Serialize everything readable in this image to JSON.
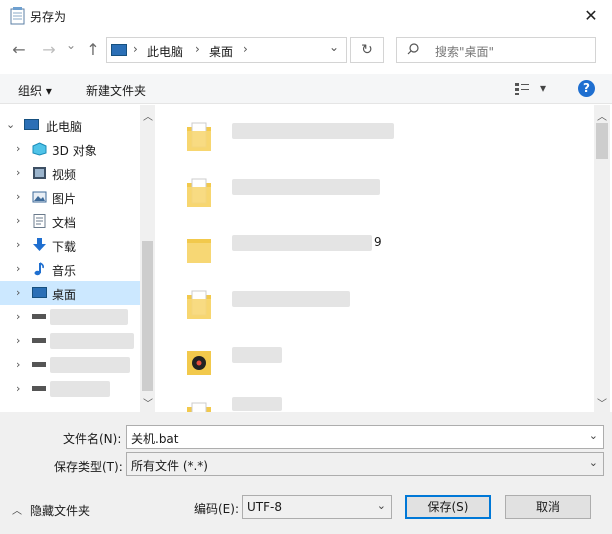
{
  "window": {
    "title": "另存为",
    "close_glyph": "✕"
  },
  "nav": {
    "back": "←",
    "forward": "→",
    "recent": "⌄",
    "up": "↑",
    "breadcrumb": [
      "此电脑",
      "桌面"
    ],
    "crumb_sep": "›",
    "dropdown": "⌄",
    "refresh": "↻",
    "search_placeholder": "搜索\"桌面\""
  },
  "toolbar": {
    "organize": "组织 ▾",
    "new_folder": "新建文件夹",
    "view_arrow": "▾",
    "help": "?"
  },
  "tree": [
    {
      "label": "此电脑",
      "icon": "pc-icon",
      "expanded": true,
      "selected": false,
      "indent": 0,
      "chev": "⌄"
    },
    {
      "label": "3D 对象",
      "icon": "3d-objects-icon",
      "selected": false,
      "indent": 1,
      "chev": "›"
    },
    {
      "label": "视频",
      "icon": "video-icon",
      "selected": false,
      "indent": 1,
      "chev": "›"
    },
    {
      "label": "图片",
      "icon": "picture-icon",
      "selected": false,
      "indent": 1,
      "chev": "›"
    },
    {
      "label": "文档",
      "icon": "document-icon",
      "selected": false,
      "indent": 1,
      "chev": "›"
    },
    {
      "label": "下载",
      "icon": "download-icon",
      "selected": false,
      "indent": 1,
      "chev": "›"
    },
    {
      "label": "音乐",
      "icon": "music-icon",
      "selected": false,
      "indent": 1,
      "chev": "›"
    },
    {
      "label": "桌面",
      "icon": "desktop-icon",
      "selected": true,
      "indent": 1,
      "chev": "›"
    }
  ],
  "files_visible_suffix": "9",
  "form": {
    "filename_label": "文件名(N):",
    "filename_value": "关机.bat",
    "filetype_label": "保存类型(T):",
    "filetype_value": "所有文件  (*.*)",
    "hide_folders": "隐藏文件夹",
    "encoding_label": "编码(E):",
    "encoding_value": "UTF-8",
    "save": "保存(S)",
    "cancel": "取消"
  },
  "colors": {
    "accent": "#0078d7",
    "selected": "#cce8ff",
    "folder": "#f2c94c"
  }
}
